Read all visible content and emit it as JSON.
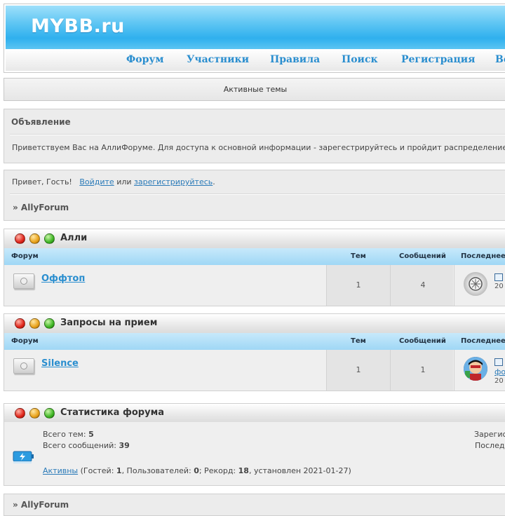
{
  "header": {
    "logo": "MYBB.ru",
    "nav": [
      "Форум",
      "Участники",
      "Правила",
      "Поиск",
      "Регистрация",
      "Во"
    ]
  },
  "active_topics": "Активные темы",
  "announcement": {
    "title": "Объявление",
    "text": "Приветствуем Вас на АллиФоруме. Для доступа к основной информации - зарегестрируйтесь и пройдит распределение"
  },
  "guest": {
    "greeting": "Привет, Гость!",
    "login": "Войдите",
    "or": "или",
    "register": "зарегистрируйтесь",
    "dot": "."
  },
  "breadcrumb": "» AllyForum",
  "columns": {
    "forum": "Форум",
    "topics": "Тем",
    "posts": "Сообщений",
    "last": "Последнее"
  },
  "categories": [
    {
      "title": "Алли",
      "forum": {
        "name": "Оффтоп",
        "topics": "1",
        "posts": "4",
        "last_date": "20"
      }
    },
    {
      "title": "Запросы на прием",
      "forum": {
        "name": "Silence",
        "topics": "1",
        "posts": "1",
        "last_link": "фо",
        "last_date": "20"
      }
    }
  ],
  "stats": {
    "title": "Статистика форума",
    "topics_label": "Всего тем:",
    "topics_value": "5",
    "posts_label": "Всего сообщений:",
    "posts_value": "39",
    "right1": "Зарегис",
    "right2": "Послед",
    "active_link": "Активны",
    "online_prefix": "(Гостей:",
    "guests": "1",
    "users_label": ", Пользователей:",
    "users": "0",
    "record_label": "; Рекорд:",
    "record": "18",
    "record_suffix": ", установлен 2021-01-27)"
  }
}
